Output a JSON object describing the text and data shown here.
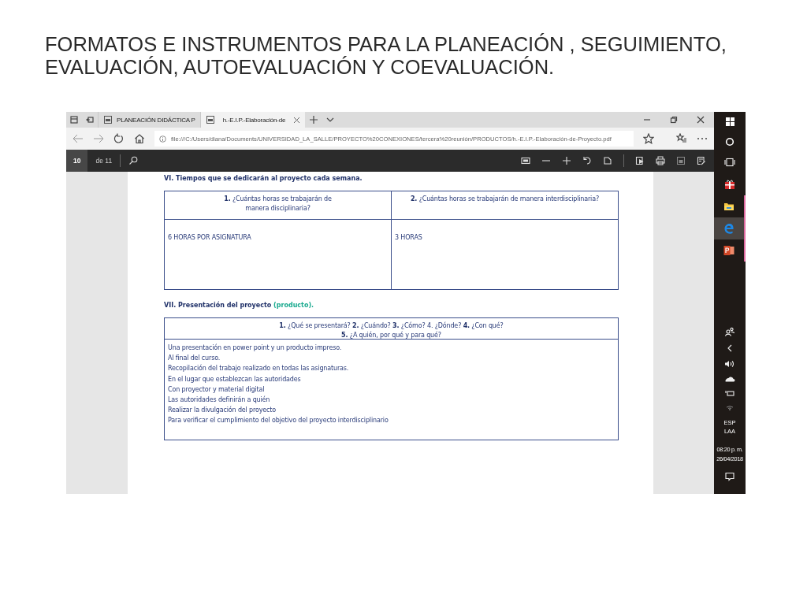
{
  "slide": {
    "title": "FORMATOS E INSTRUMENTOS PARA LA PLANEACIÓN , SEGUIMIENTO, EVALUACIÓN, AUTOEVALUACIÓN Y COEVALUACIÓN."
  },
  "browser": {
    "tabs": [
      {
        "label": "PLANEACIÓN DIDÁCTICA P",
        "selected": false
      },
      {
        "label": "h.-E.I.P.-Elaboración-de",
        "selected": true
      }
    ],
    "address": "file:///C:/Users/diana/Documents/UNIVERSIDAD_LA_SALLE/PROYECTO%20CONEXIONES/tercera%20reunión/PRODUCTOS/h.-E.I.P.-Elaboración-de-Proyecto.pdf",
    "page_number": "10",
    "page_count": "de 11"
  },
  "document": {
    "sections": [
      {
        "heading": "VI. Tiempos que se dedicarán al proyecto cada semana.",
        "columns": [
          {
            "header": [
              "**1.**   ¿Cuántas horas se trabajarán de manera disciplinaria?"
            ],
            "body": [
              "6 HORAS POR ASIGNATURA"
            ]
          },
          {
            "header": [
              "**2.** ¿Cuántas horas se trabajarán de manera interdisciplinaria?"
            ],
            "body": [
              "3 HORAS"
            ]
          }
        ]
      },
      {
        "heading": "VII. Presentación del proyecto",
        "heading_note": "(producto).",
        "columns": [
          {
            "header": [
              "**1.**   ¿Qué se presentará?   **2.** ¿Cuándo?   **3.** ¿Cómo?  4. ¿Dónde?   **4.** ¿Con qué?",
              "**5.** ¿A quién, por qué y para qué?"
            ],
            "body": [
              "Una presentación en power point  y un producto impreso.",
              "Al final del curso.",
              "Recopilación del trabajo realizado en todas las asignaturas.",
              "En el lugar que establezcan las autoridades",
              "Con proyector y material digital",
              "Las autoridades definirán a quién",
              "Realizar la divulgación del proyecto",
              "Para verificar el cumplimiento del objetivo del proyecto interdisciplinario"
            ]
          }
        ]
      }
    ]
  },
  "taskbar": {
    "apps": [
      {
        "kind": "gift",
        "running": false,
        "selected": false
      },
      {
        "kind": "folder",
        "running": true,
        "selected": false
      },
      {
        "kind": "edge",
        "running": true,
        "selected": true
      },
      {
        "kind": "powerpoint",
        "running": true,
        "selected": false
      }
    ],
    "language": "ESP",
    "layout": "LAA",
    "time": "08:20 p. m.",
    "date": "26/04/2018"
  }
}
